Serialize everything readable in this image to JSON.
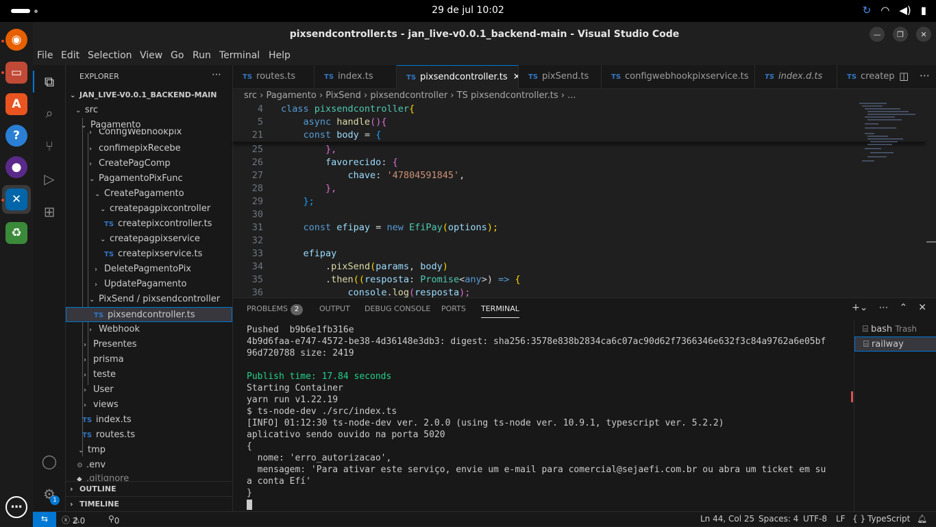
{
  "topbar": {
    "clock": "29 de jul  10:02"
  },
  "window": {
    "title": "pixsendcontroller.ts - jan_live-v0.0.1_backend-main - Visual Studio Code"
  },
  "menu": [
    "File",
    "Edit",
    "Selection",
    "View",
    "Go",
    "Run",
    "Terminal",
    "Help"
  ],
  "activity": {
    "settings_badge": "1"
  },
  "explorer": {
    "header": "EXPLORER",
    "root": "JAN_LIVE-V0.0.1_BACKEND-MAIN",
    "tree": [
      {
        "label": "src",
        "type": "open"
      },
      {
        "label": "Pagamento",
        "type": "open"
      },
      {
        "label": "ConfigWebhookpix",
        "type": "closed"
      },
      {
        "label": "confimepixRecebe",
        "type": "closed"
      },
      {
        "label": "CreatePagComp",
        "type": "closed"
      },
      {
        "label": "PagamentoPixFunc",
        "type": "open"
      },
      {
        "label": "CreatePagamento",
        "type": "open"
      },
      {
        "label": "createpagpixcontroller",
        "type": "open"
      },
      {
        "label": "createpixcontroller.ts",
        "type": "file"
      },
      {
        "label": "createpagpixservice",
        "type": "open"
      },
      {
        "label": "createpixservice.ts",
        "type": "file"
      },
      {
        "label": "DeletePagmentoPix",
        "type": "closed"
      },
      {
        "label": "UpdatePagamento",
        "type": "closed"
      },
      {
        "label": "PixSend / pixsendcontroller",
        "type": "open"
      },
      {
        "label": "pixsendcontroller.ts",
        "type": "file"
      },
      {
        "label": "Webhook",
        "type": "closed"
      },
      {
        "label": "Presentes",
        "type": "closed"
      },
      {
        "label": "prisma",
        "type": "closed"
      },
      {
        "label": "teste",
        "type": "closed"
      },
      {
        "label": "User",
        "type": "closed"
      },
      {
        "label": "views",
        "type": "closed"
      },
      {
        "label": "index.ts",
        "type": "file"
      },
      {
        "label": "routes.ts",
        "type": "file"
      },
      {
        "label": "tmp",
        "type": "open"
      },
      {
        "label": ".env",
        "type": "gear"
      },
      {
        "label": ".gitignore",
        "type": "file"
      }
    ],
    "outline": "OUTLINE",
    "timeline": "TIMELINE"
  },
  "tabs": [
    {
      "label": "routes.ts"
    },
    {
      "label": "index.ts"
    },
    {
      "label": "pixsendcontroller.ts"
    },
    {
      "label": "pixSend.ts"
    },
    {
      "label": "configwebhookpixservice.ts"
    },
    {
      "label": "index.d.ts"
    },
    {
      "label": "createpi"
    }
  ],
  "breadcrumb": "src  ›  Pagamento  ›  PixSend  ›  pixsendcontroller  ›  TS  pixsendcontroller.ts  ›  ...",
  "editor": {
    "line_numbers": [
      "4",
      "5",
      "21",
      "25",
      "26",
      "27",
      "28",
      "29",
      "30",
      "31",
      "32",
      "33",
      "34",
      "35",
      "36"
    ],
    "text": {
      "l4a": "class ",
      "l4b": "pixsendcontroller",
      "l4c": "{",
      "l5a": "async ",
      "l5b": "handle",
      "l5c": "(){",
      "l21a": "const ",
      "l21b": "body",
      "l21c": " = ",
      "l21d": "{",
      "l25": "},",
      "l26a": "favorecido",
      "l26b": ": ",
      "l26c": "{",
      "l27a": "chave",
      "l27b": ": ",
      "l27c": "'47804591845'",
      "l27d": ",",
      "l28": "},",
      "l29": "};",
      "l31a": "const ",
      "l31b": "efipay",
      "l31c": " = ",
      "l31d": "new ",
      "l31e": "EfiPay",
      "l31f": "(",
      "l31g": "options",
      "l31h": ");",
      "l33": "efipay",
      "l34a": ".",
      "l34b": "pixSend",
      "l34c": "(",
      "l34d": "params",
      "l34e": ", ",
      "l34f": "body",
      "l34g": ")",
      "l35a": ".",
      "l35b": "then",
      "l35c": "((",
      "l35d": "resposta",
      "l35e": ": ",
      "l35f": "Promise",
      "l35g": "<",
      "l35h": "any",
      "l35i": ">) ",
      "l35j": "=>",
      "l35k": " {",
      "l36a": "console",
      "l36b": ".",
      "l36c": "log",
      "l36d": "(",
      "l36e": "resposta",
      "l36f": ");"
    }
  },
  "panel": {
    "tabs": [
      "PROBLEMS",
      "OUTPUT",
      "DEBUG CONSOLE",
      "PORTS",
      "TERMINAL"
    ],
    "problems_count": "2",
    "terminal_lines": [
      "Pushed  b9b6e1fb316e",
      "4b9d6faa-e747-4572-be38-4d36148e3db3: digest: sha256:3578e838b2834ca6c07ac90d62f7366346e632f3c84a9762a6e05bf",
      "96d720788 size: 2419",
      "",
      "Publish time: 17.84 seconds",
      "Starting Container",
      "yarn run v1.22.19",
      "$ ts-node-dev ./src/index.ts",
      "[INFO] 01:12:30 ts-node-dev ver. 2.0.0 (using ts-node ver. 10.9.1, typescript ver. 5.2.2)",
      "aplicativo sendo ouvido na porta 5020",
      "{",
      "  nome: 'erro_autorizacao',",
      "  mensagem: 'Para ativar este serviço, envie um e-mail para comercial@sejaefi.com.br ou abra um ticket em su",
      "a conta Efí'",
      "}"
    ],
    "terminals": [
      {
        "name": "bash",
        "extra": "Trash"
      },
      {
        "name": "railway",
        "extra": ""
      }
    ]
  },
  "status": {
    "errors": "2",
    "warnings": "0",
    "ports": "0",
    "position": "Ln 44, Col 25",
    "spaces": "Spaces: 4",
    "encoding": "UTF-8",
    "eol": "LF",
    "lang_braces": "{ }",
    "language": "TypeScript"
  },
  "colors": {
    "accent": "#0078d4",
    "ts": "#3178c6",
    "terminal_green": "#23d18b"
  }
}
